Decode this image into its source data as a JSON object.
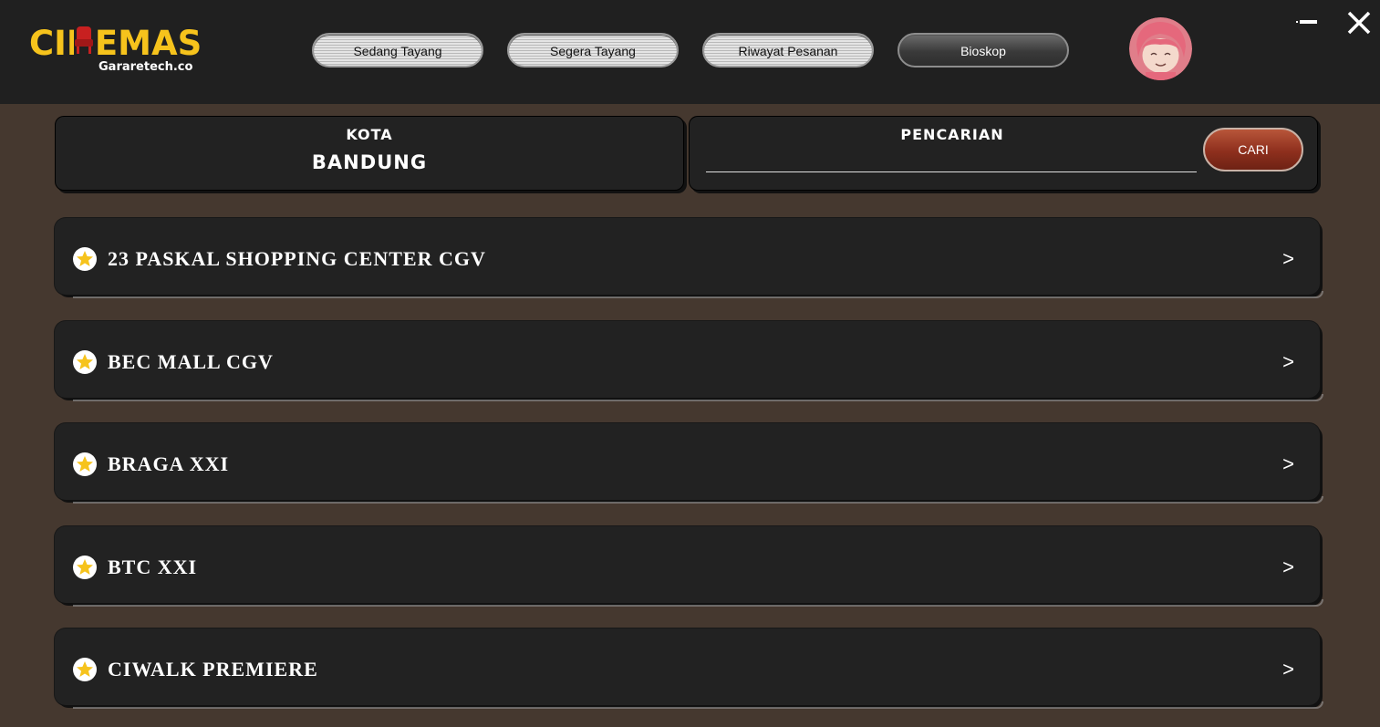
{
  "app": {
    "logo_text": "CINEMAS",
    "logo_subtitle": "Gararetech.co"
  },
  "nav": {
    "items": [
      {
        "label": "Sedang Tayang",
        "active": false
      },
      {
        "label": "Segera Tayang",
        "active": false
      },
      {
        "label": "Riwayat Pesanan",
        "active": false
      },
      {
        "label": "Bioskop",
        "active": true
      }
    ]
  },
  "filters": {
    "city_label": "KOTA",
    "city_value": "BANDUNG",
    "search_label": "PENCARIAN",
    "search_value": "",
    "search_button": "CARI"
  },
  "cinemas": [
    {
      "name": "23 PASKAL SHOPPING CENTER CGV",
      "arrow": ">"
    },
    {
      "name": "BEC MALL CGV",
      "arrow": ">"
    },
    {
      "name": "BRAGA XXI",
      "arrow": ">"
    },
    {
      "name": "BTC XXI",
      "arrow": ">"
    },
    {
      "name": "CIWALK PREMIERE",
      "arrow": ">"
    }
  ],
  "colors": {
    "background": "#45382f",
    "header": "#202020",
    "card": "#222222",
    "logo_yellow": "#f6c31c",
    "cari_button": "#8e2f1d",
    "star": "#f6c31c"
  },
  "icons": {
    "avatar": "avatar",
    "minimize": "minimize-icon",
    "close": "close-icon",
    "favorite": "star-icon"
  }
}
